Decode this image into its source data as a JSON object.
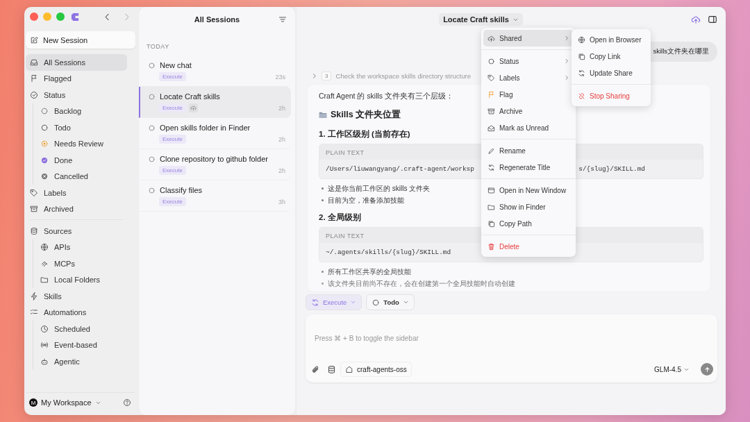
{
  "sidebar": {
    "new_session": "New Session",
    "items": [
      {
        "label": "All Sessions",
        "selected": true
      },
      {
        "label": "Flagged",
        "selected": false
      },
      {
        "label": "Status",
        "selected": false,
        "children": [
          {
            "label": "Backlog",
            "selected": false
          },
          {
            "label": "Todo",
            "selected": false
          },
          {
            "label": "Needs Review",
            "selected": false
          },
          {
            "label": "Done",
            "selected": false
          },
          {
            "label": "Cancelled",
            "selected": false
          }
        ]
      },
      {
        "label": "Labels",
        "selected": false
      },
      {
        "label": "Archived",
        "selected": false
      },
      {
        "label": "Sources",
        "selected": false,
        "children": [
          {
            "label": "APIs",
            "selected": false
          },
          {
            "label": "MCPs",
            "selected": false
          },
          {
            "label": "Local Folders",
            "selected": false
          }
        ]
      },
      {
        "label": "Skills",
        "selected": false
      },
      {
        "label": "Automations",
        "selected": false,
        "children": [
          {
            "label": "Scheduled",
            "selected": false
          },
          {
            "label": "Event-based",
            "selected": false
          },
          {
            "label": "Agentic",
            "selected": false
          }
        ]
      }
    ],
    "workspace": {
      "avatar": "M",
      "name": "My Workspace"
    }
  },
  "session_list": {
    "title": "All Sessions",
    "section": "TODAY",
    "sessions": [
      {
        "title": "New chat",
        "tag": "Execute",
        "time": "23s",
        "selected": false,
        "shared": false
      },
      {
        "title": "Locate Craft skills",
        "tag": "Execute",
        "time": "2h",
        "selected": true,
        "shared": true
      },
      {
        "title": "Open skills folder in Finder",
        "tag": "Execute",
        "time": "2h",
        "selected": false,
        "shared": false
      },
      {
        "title": "Clone repository to github folder",
        "tag": "Execute",
        "time": "2h",
        "selected": false,
        "shared": false
      },
      {
        "title": "Classify files",
        "tag": "Execute",
        "time": "3h",
        "selected": false,
        "shared": false
      }
    ]
  },
  "chat": {
    "title": "Locate Craft skills",
    "user_message": "skills文件夹在哪里",
    "step": {
      "number": "3",
      "text": "Check the workspace skills directory structure"
    },
    "response": {
      "intro": "Craft Agent 的 skills 文件夹有三个层级：",
      "heading": "Skills 文件夹位置",
      "sections": [
        {
          "heading": "1. 工作区级别 (当前存在)",
          "code_label": "PLAIN TEXT",
          "code_start": "/Users/liuwangyang/.craft-agent/worksp",
          "code_end": "s/{slug}/SKILL.md",
          "bullets": [
            "这是你当前工作区的 skills 文件夹",
            "目前为空，准备添加技能"
          ]
        },
        {
          "heading": "2. 全局级别",
          "code_label": "PLAIN TEXT",
          "code_start": "~/.agents/skills/{slug}/SKILL.md",
          "bullets": [
            "所有工作区共享的全局技能",
            "该文件夹目前尚不存在，会在创建第一个全局技能时自动创建"
          ]
        }
      ]
    },
    "mode_chip": "Execute",
    "status_chip": "Todo",
    "composer": {
      "placeholder": "Press ⌘ + B to toggle the sidebar",
      "source": "craft-agents-oss",
      "model": "GLM-4.5"
    }
  },
  "context_menu": {
    "groups": [
      [
        {
          "label": "Shared",
          "selected": true,
          "submenu": true,
          "danger": false
        }
      ],
      [
        {
          "label": "Status",
          "selected": false,
          "submenu": true,
          "danger": false
        },
        {
          "label": "Labels",
          "selected": false,
          "submenu": true,
          "danger": false
        },
        {
          "label": "Flag",
          "selected": false,
          "submenu": false,
          "danger": false
        },
        {
          "label": "Archive",
          "selected": false,
          "submenu": false,
          "danger": false
        },
        {
          "label": "Mark as Unread",
          "selected": false,
          "submenu": false,
          "danger": false
        }
      ],
      [
        {
          "label": "Rename",
          "selected": false,
          "submenu": false,
          "danger": false
        },
        {
          "label": "Regenerate Title",
          "selected": false,
          "submenu": false,
          "danger": false
        }
      ],
      [
        {
          "label": "Open in New Window",
          "selected": false,
          "submenu": false,
          "danger": false
        },
        {
          "label": "Show in Finder",
          "selected": false,
          "submenu": false,
          "danger": false
        },
        {
          "label": "Copy Path",
          "selected": false,
          "submenu": false,
          "danger": false
        }
      ],
      [
        {
          "label": "Delete",
          "selected": false,
          "submenu": false,
          "danger": true
        }
      ]
    ]
  },
  "submenu": {
    "groups": [
      [
        {
          "label": "Open in Browser",
          "danger": false
        },
        {
          "label": "Copy Link",
          "danger": false
        },
        {
          "label": "Update Share",
          "danger": false
        }
      ],
      [
        {
          "label": "Stop Sharing",
          "danger": true
        }
      ]
    ]
  }
}
